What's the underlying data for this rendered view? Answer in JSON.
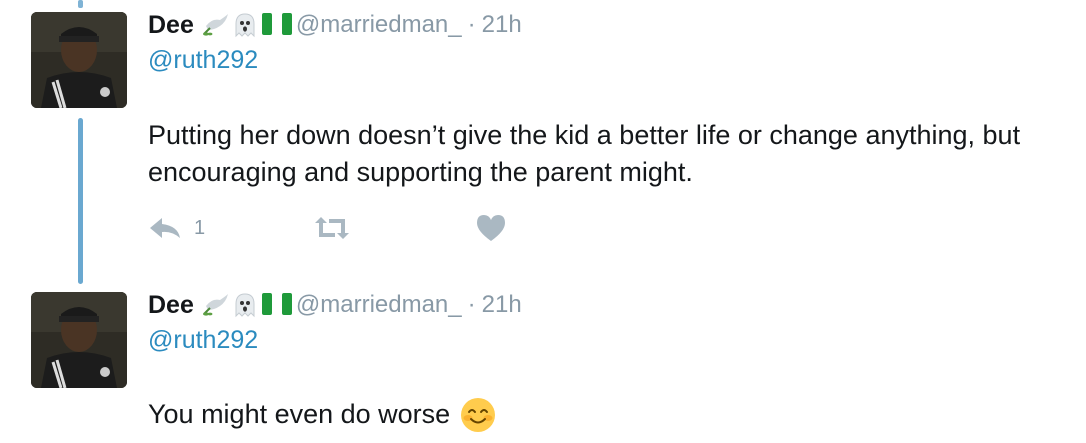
{
  "tweets": [
    {
      "name": "Dee",
      "emoji_icons": [
        "dove-olive-branch-icon",
        "ghost-icon",
        "nigeria-flag-icon"
      ],
      "handle": "@marriedman_",
      "separator": "·",
      "time": "21h",
      "reply_to": "@ruth292",
      "text": "Putting her down doesn’t give the kid a better life or change anything, but encouraging and supporting the parent might.",
      "actions": {
        "reply_count": "1",
        "icons": [
          "reply-icon",
          "retweet-icon",
          "like-heart-icon"
        ]
      }
    },
    {
      "name": "Dee",
      "emoji_icons": [
        "dove-olive-branch-icon",
        "ghost-icon",
        "nigeria-flag-icon"
      ],
      "handle": "@marriedman_",
      "separator": "·",
      "time": "21h",
      "reply_to": "@ruth292",
      "text": "You might even do worse",
      "trailing_emoji": "smiling-face-with-smiling-eyes-icon"
    }
  ],
  "colors": {
    "link": "#2b8bbf",
    "muted": "#8899a6",
    "thread_line": "#6aa8d0",
    "nigeria_green": "#1f9a3a"
  }
}
